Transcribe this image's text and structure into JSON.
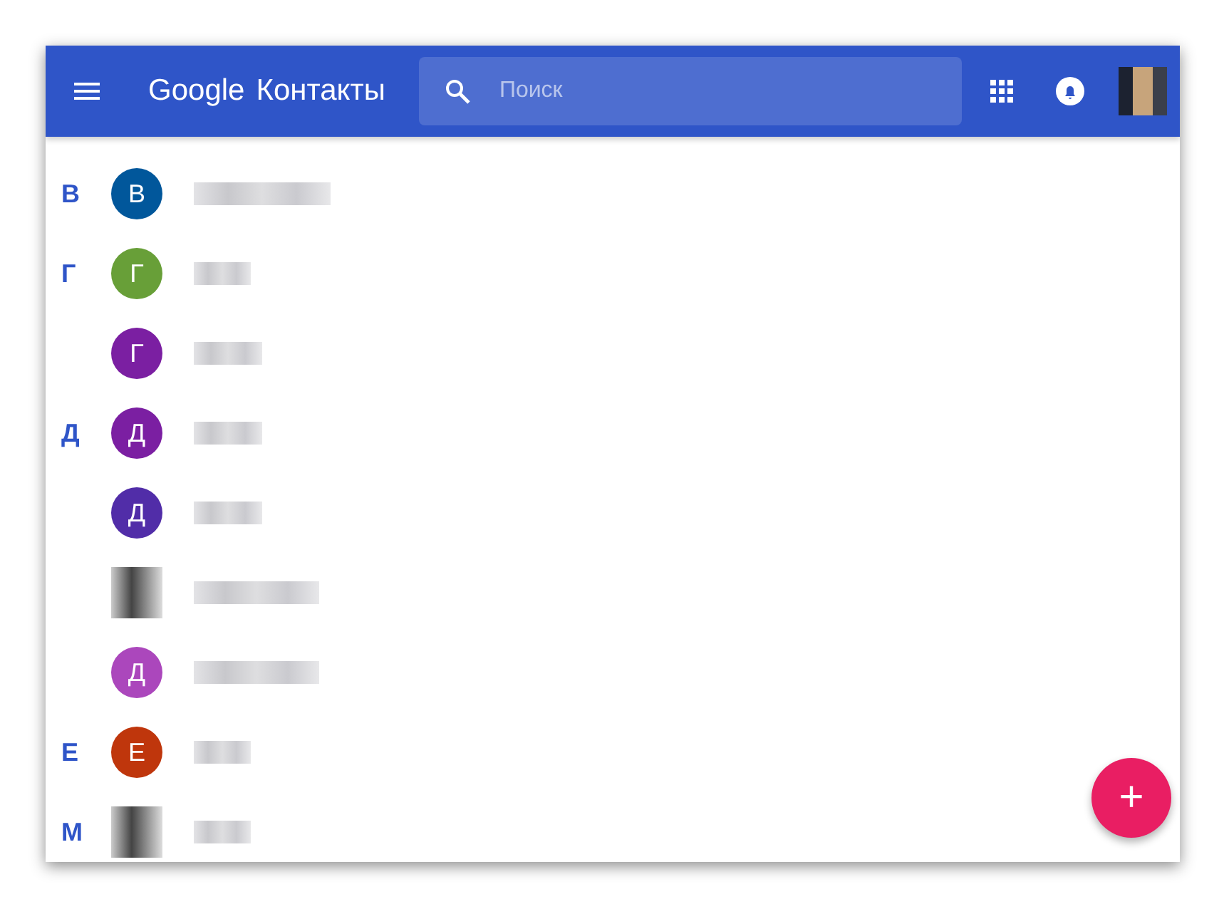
{
  "header": {
    "logo_brand": "Google",
    "logo_product": "Контакты",
    "search": {
      "placeholder": "Поиск"
    }
  },
  "contacts": [
    {
      "section": "В",
      "avatar": {
        "kind": "letter",
        "letter": "В",
        "color": "#01579b"
      }
    },
    {
      "section": "Г",
      "avatar": {
        "kind": "letter",
        "letter": "Г",
        "color": "#689f38"
      }
    },
    {
      "avatar": {
        "kind": "letter",
        "letter": "Г",
        "color": "#7b1fa2"
      }
    },
    {
      "section": "Д",
      "avatar": {
        "kind": "letter",
        "letter": "Д",
        "color": "#7b1fa2"
      }
    },
    {
      "avatar": {
        "kind": "letter",
        "letter": "Д",
        "color": "#512da8"
      }
    },
    {
      "avatar": {
        "kind": "photo"
      }
    },
    {
      "avatar": {
        "kind": "letter",
        "letter": "Д",
        "color": "#ab47bc"
      }
    },
    {
      "section": "Е",
      "avatar": {
        "kind": "letter",
        "letter": "Е",
        "color": "#bf360c"
      }
    },
    {
      "section": "М",
      "avatar": {
        "kind": "photo"
      }
    }
  ],
  "fab": {
    "label": "+"
  }
}
